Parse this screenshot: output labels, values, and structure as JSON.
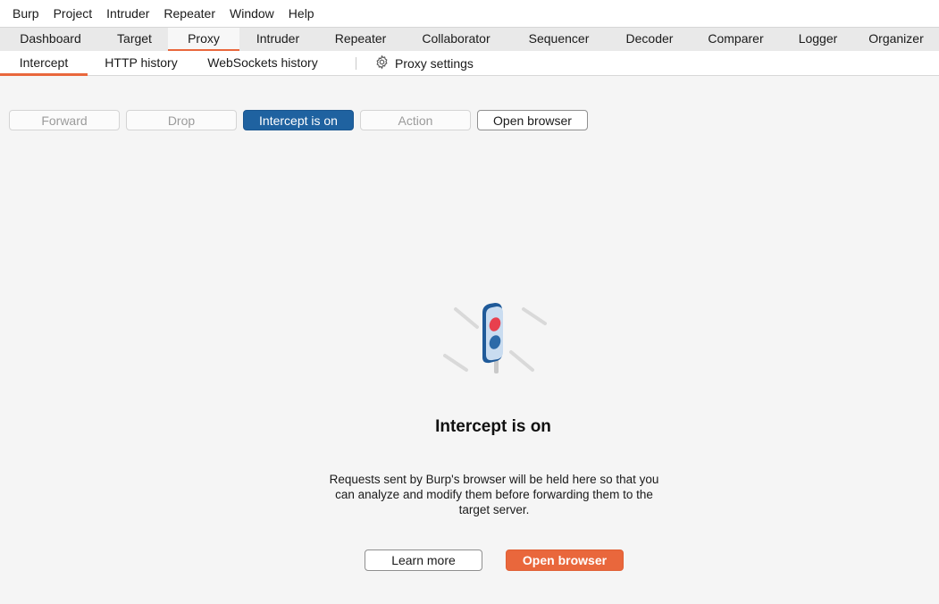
{
  "menubar": {
    "items": [
      "Burp",
      "Project",
      "Intruder",
      "Repeater",
      "Window",
      "Help"
    ]
  },
  "main_tabs": {
    "items": [
      "Dashboard",
      "Target",
      "Proxy",
      "Intruder",
      "Repeater",
      "Collaborator",
      "Sequencer",
      "Decoder",
      "Comparer",
      "Logger",
      "Organizer"
    ],
    "active": "Proxy"
  },
  "sub_tabs": {
    "items": [
      "Intercept",
      "HTTP history",
      "WebSockets history"
    ],
    "active": "Intercept",
    "settings_label": "Proxy settings",
    "settings_icon": "gear-icon"
  },
  "toolbar": {
    "forward_label": "Forward",
    "drop_label": "Drop",
    "intercept_label": "Intercept is on",
    "action_label": "Action",
    "open_browser_label": "Open browser"
  },
  "empty_state": {
    "icon": "traffic-light-icon",
    "title": "Intercept is on",
    "description": "Requests sent by Burp's browser will be held here so that you can analyze and modify them before forwarding them to the target server.",
    "learn_more_label": "Learn more",
    "open_browser_label": "Open browser"
  },
  "colors": {
    "accent": "#e9673c",
    "primary_blue": "#1f62a0",
    "background": "#f5f5f5"
  }
}
